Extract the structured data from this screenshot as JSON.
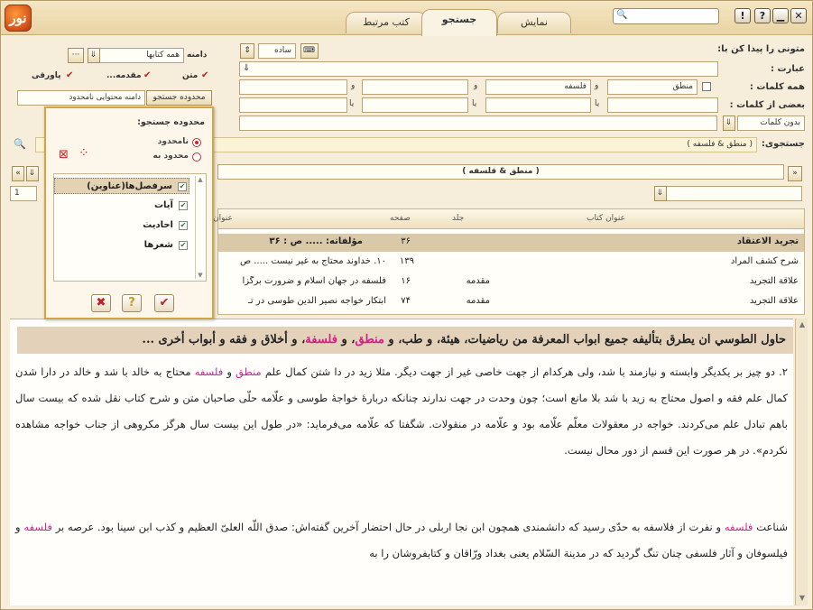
{
  "app": {
    "logo_text": "نور"
  },
  "tabs": {
    "view": "نمایش",
    "search": "جستجو",
    "related": "کتب مرتبط"
  },
  "window": {
    "close": "✕",
    "minimize": "▁",
    "help": "?",
    "info": "!",
    "search_icon": "search-icon"
  },
  "form": {
    "find_label": "متونی را پیدا کن با:",
    "mode_value": "ساده",
    "phrase_label": "عبارت :",
    "all_words_label": "همه کلمات :",
    "all_words": [
      "منطق",
      "فلسفه",
      "",
      ""
    ],
    "and_word": "و",
    "some_words_label": "بعضی از کلمات :",
    "or_word": "یا",
    "without_value": "بدون کلمات",
    "search_label": "جستجوی:",
    "search_expr": "( منطق & فلسفه )",
    "domain_label": "دامنه",
    "domain_value": "همه کتابها",
    "text_label": "متن",
    "intro_label": "مقدمه...",
    "footnote_label": "پاورقی",
    "scope_button": "محدوده جستجو",
    "scope_value": "دامنه محتوایی نامحدود"
  },
  "result_bar": {
    "expr": "( منطق & فلسفه )",
    "page_value": "1"
  },
  "table": {
    "headers": {
      "book": "عنوان کتاب",
      "volume": "جلد",
      "page": "صفحه",
      "address": "عنوان"
    },
    "rows": [
      {
        "book": "تجريد الاعتقاد",
        "volume": "",
        "page": "۳۶",
        "title": "مؤلفاته: ..... ص : ۳۶"
      },
      {
        "book": "شرح كشف المراد",
        "volume": "",
        "page": "۱۳۹",
        "title": "۱۰. خداوند محتاج به غير نيست ..... ص"
      },
      {
        "book": "علاقة التجريد",
        "volume": "مقدمه",
        "page": "۱۶",
        "title": "فلسفه در جهان اسلام و ضرورت برگزا"
      },
      {
        "book": "علاقة التجريد",
        "volume": "مقدمه",
        "page": "۷۴",
        "title": "ابتكار خواجه نصير الدين طوسى در تـ"
      }
    ]
  },
  "popup": {
    "title": "محدوده جستجو:",
    "unlimited": "نامحدود",
    "limited": "محدود به",
    "items": [
      "سرفصل‌ها(عناوین)",
      "آیات",
      "احادیث",
      "شعرها"
    ],
    "ok": "✔",
    "help": "?",
    "cancel": "✖"
  },
  "reader": {
    "heading_pre": "حاول الطوسي ان يطرق بتأليفه جميع ابواب المعرفة من رياضيات، هيئة، و طب، و ",
    "heading_h1": "منطق",
    "heading_mid": "، و ",
    "heading_h2": "فلسفة",
    "heading_post": "، و أخلاق و فقه و أبواب أخرى ...",
    "p1_a": "۲. دو چيز بر يكديگر وابسته و نيازمند با شد، ولى هركدام از جهت خاصى غير از جهت ديگر. مثلا زيد در دا شتن كمال علم ",
    "p1_h1": "منطق",
    "p1_b": " و ",
    "p1_h2": "فلسفه",
    "p1_c": " محتاج به خالد با شد و خالد در دارا شدن كمال علم فقه و اصول محتاج به زيد با شد بلا مانع است؛ چون وحدت در جهت ندارند چنانكه دربارۀ خواجۀ طوسى و علّامه حلّى صاحبان متن و شرح كتاب نقل شده كه بيست سال باهم تبادل علم مى‌كردند. خواجه در معقولات معلّم علّامه بود و علّامه در منقولات. شگفتا كه علّامه مى‌فرمايد: «در طول اين بيست سال هرگز مكروهى از جناب خواجه مشاهده نكردم». در هر صورت اين قسم از دور محال نيست.",
    "p2_a": "شناعت ",
    "p2_h1": "فلسفه",
    "p2_b": " و نفرت از فلاسفه به حدّى رسيد كه دانشمندى همچون ابن نجا اربلى در حال احتضار آخرين گفته‌اش: صدق اللّه العلىّ العظيم و كذب ابن سينا بود. عرصه بر ",
    "p2_h2": "فلسفه",
    "p2_c": " و فيلسوفان و آثار فلسفى چنان تنگ گرديد كه در مدينة السّلام يعنى بغداد ورّاقان و كتابفروشان را به"
  }
}
